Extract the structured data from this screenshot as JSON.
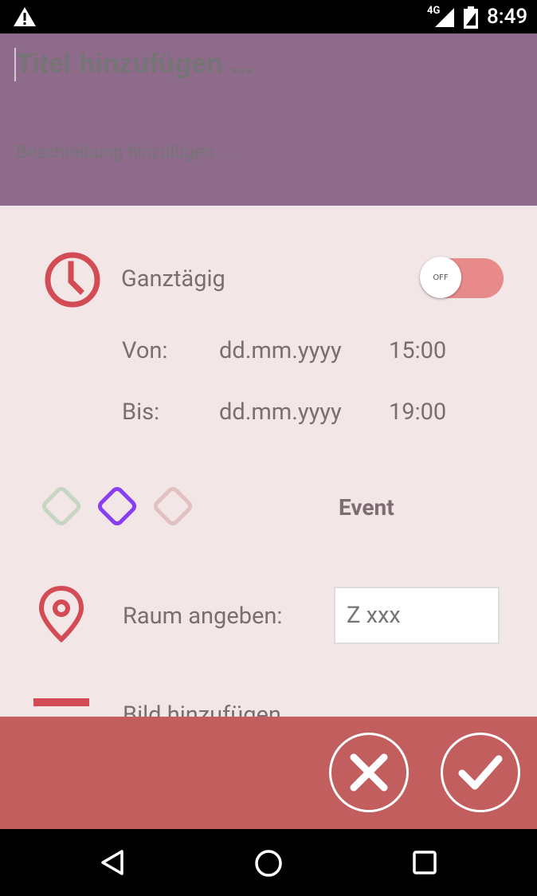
{
  "status": {
    "network": "4G",
    "time": "8:49"
  },
  "header": {
    "title_placeholder": "Titel hinzufügen ...",
    "description_placeholder": "Beschreibung hinzufügen ..."
  },
  "form": {
    "all_day_label": "Ganztägig",
    "all_day_state": "OFF",
    "from": {
      "label": "Von:",
      "date": "dd.mm.yyyy",
      "time": "15:00"
    },
    "to": {
      "label": "Bis:",
      "date": "dd.mm.yyyy",
      "time": "19:00"
    },
    "categories": [
      {
        "name": "green",
        "color": "#c7d5c4",
        "selected": false
      },
      {
        "name": "purple",
        "color": "#8a3ef2",
        "selected": true
      },
      {
        "name": "pink",
        "color": "#e1c1c1",
        "selected": false
      }
    ],
    "category": "Event",
    "room_label": "Raum angeben:",
    "room_placeholder": "Z xxx",
    "add_image_label": "Bild hinzufügen"
  },
  "colors": {
    "header": "#8e6a8b",
    "background": "#f2e6e6",
    "accent": "#d34c55",
    "action_bar": "#c25e5e",
    "toggle_track": "#e88a8a"
  },
  "icons": [
    "warning-icon",
    "signal-icon",
    "battery-icon",
    "clock-icon",
    "location-pin-icon",
    "close-icon",
    "checkmark-icon",
    "back-icon",
    "home-icon",
    "recents-icon"
  ]
}
